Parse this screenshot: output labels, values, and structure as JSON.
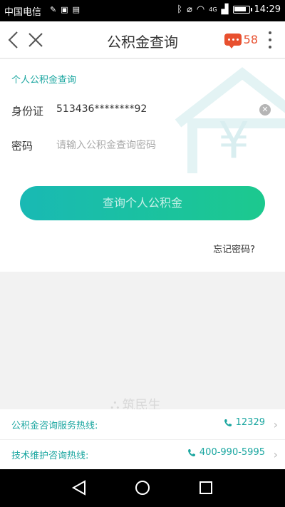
{
  "status_bar": {
    "carrier": "中国电信",
    "network": "4G",
    "time": "14:29",
    "battery_level": 0.85
  },
  "header": {
    "title": "公积金查询",
    "message_count": "58",
    "back_icon": "chevron-left-icon",
    "close_icon": "close-icon",
    "more_icon": "more-vertical-icon"
  },
  "form": {
    "section_label": "个人公积金查询",
    "id_label": "身份证",
    "id_value": "513436********92",
    "password_label": "密码",
    "password_placeholder": "请输入公积金查询密码",
    "submit_label": "查询个人公积金",
    "forgot_label": "忘记密码?"
  },
  "watermark": "筑民生",
  "hotlines": [
    {
      "name": "公积金咨询服务热线:",
      "number": "12329"
    },
    {
      "name": "技术维护咨询热线:",
      "number": "400-990-5995"
    }
  ],
  "colors": {
    "accent": "#1aa6a0",
    "badge": "#e8502f",
    "button_start": "#19b9b4",
    "button_end": "#1cc98e"
  }
}
